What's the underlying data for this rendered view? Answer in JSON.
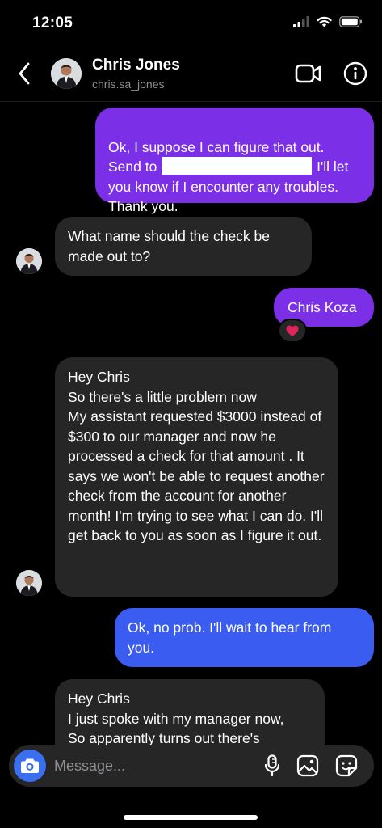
{
  "status_bar": {
    "time": "12:05"
  },
  "header": {
    "name": "Chris Jones",
    "username": "chris.sa_jones"
  },
  "messages": [
    {
      "from": "me",
      "text_before": "Ok, I suppose I can figure that out. Send to ",
      "text_after": " I'll let you know if I encounter any troubles. Thank you.",
      "redacted": true
    },
    {
      "from": "them",
      "text": "What name should the check be made out to?"
    },
    {
      "from": "me",
      "text": "Chris Koza",
      "reaction": "heart"
    },
    {
      "from": "them",
      "text": "Hey Chris\nSo there's a little problem now\nMy assistant requested $3000 instead of $300 to our manager and now he processed a check for that amount . It says we won't be able to request another check from the account for another month! I'm trying to see what I can do. I'll get back to you as soon as I figure it out."
    },
    {
      "from": "me",
      "text": "Ok, no prob. I'll wait to hear from you."
    },
    {
      "from": "them",
      "text": "Hey Chris\nI just spoke with my manager now,\nSo apparently turns out there's"
    }
  ],
  "composer": {
    "placeholder": "Message..."
  },
  "icons": {
    "back": "chevron-left-icon",
    "video": "video-camera-icon",
    "info": "info-icon",
    "camera": "camera-icon",
    "mic": "microphone-icon",
    "gallery": "gallery-icon",
    "sticker": "sticker-icon",
    "reaction": "heart-icon"
  },
  "colors": {
    "purple_bubble": "#7b2fe6",
    "blue_bubble": "#3a5cf0",
    "incoming_bubble": "#262626",
    "camera_button": "#3a6ff0",
    "heart": "#e0245e"
  }
}
